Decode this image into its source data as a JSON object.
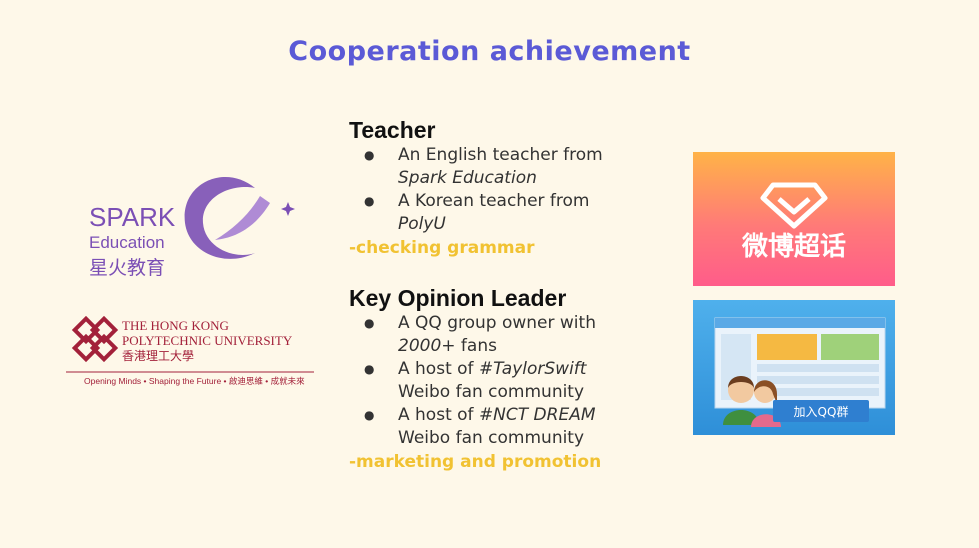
{
  "title": "Cooperation achievement",
  "teacher": {
    "heading": "Teacher",
    "items": [
      {
        "text": "An English teacher from ",
        "italic": "Spark Education"
      },
      {
        "text": "A Korean teacher from ",
        "italic": "PolyU"
      }
    ],
    "note": "-checking grammar"
  },
  "kol": {
    "heading": "Key Opinion Leader",
    "items": [
      {
        "text": "A QQ group owner with ",
        "italic": "2000+",
        "suffix": " fans"
      },
      {
        "text": "A host of ",
        "italic": "#TaylorSwift",
        "suffix": " Weibo fan community"
      },
      {
        "text": "A host of ",
        "italic": "#NCT DREAM",
        "suffix": " Weibo fan community"
      }
    ],
    "note": "-marketing and promotion"
  },
  "logos": {
    "spark_word": "SPARK",
    "spark_sub": "Education",
    "spark_cn": "星火教育",
    "polyu_line1": "THE HONG KONG",
    "polyu_line2": "POLYTECHNIC UNIVERSITY",
    "polyu_cn": "香港理工大學",
    "polyu_motto": "Opening Minds • Shaping the Future • 啟迪思維 • 成就未來"
  },
  "images": {
    "weibo_text": "微博超话",
    "qq_button": "加入QQ群"
  },
  "colors": {
    "title": "#5b5ad6",
    "note": "#f1c232",
    "spark": "#7b4fb5",
    "polyu": "#a3213a"
  }
}
